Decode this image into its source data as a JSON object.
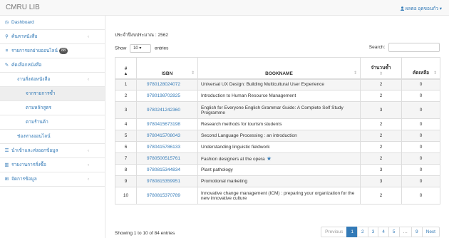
{
  "app": {
    "brand": "CMRU LIB",
    "user": "ผลตอ อุดขอนกัว"
  },
  "sidebar": {
    "items": [
      {
        "label": "Dashboard",
        "icon": "dashboard-icon",
        "glyph": "◷",
        "level": 1,
        "arrow": "",
        "badge": "",
        "active": false
      },
      {
        "label": "ค้นหาหนังสือ",
        "icon": "search-icon",
        "glyph": "⚲",
        "level": 1,
        "arrow": "‹",
        "badge": "",
        "active": false
      },
      {
        "label": "รายการยกย่ายออนไลน์",
        "icon": "cart-icon",
        "glyph": "≡",
        "level": 1,
        "arrow": "",
        "badge": "88",
        "active": false
      },
      {
        "label": "คัดเลือกหนังสือ",
        "icon": "edit-icon",
        "glyph": "✎",
        "level": 1,
        "arrow": "",
        "badge": "",
        "active": false
      },
      {
        "label": "งานสั่งต่อหนังสือ",
        "icon": "",
        "glyph": "",
        "level": 2,
        "arrow": "‹",
        "badge": "",
        "active": false
      },
      {
        "label": "จากรายการซ้ำ",
        "icon": "",
        "glyph": "",
        "level": 3,
        "arrow": "",
        "badge": "",
        "active": true
      },
      {
        "label": "ตามหลักสูตร",
        "icon": "",
        "glyph": "",
        "level": 3,
        "arrow": "",
        "badge": "",
        "active": false
      },
      {
        "label": "ตามร้านค้า",
        "icon": "",
        "glyph": "",
        "level": 3,
        "arrow": "",
        "badge": "",
        "active": false
      },
      {
        "label": "ช่องทางออนไลน์",
        "icon": "",
        "glyph": "",
        "level": 2,
        "arrow": "",
        "badge": "",
        "active": false
      },
      {
        "label": "นำเข้าและส่งออกข้อมูล",
        "icon": "list-icon",
        "glyph": "☰",
        "level": 1,
        "arrow": "‹",
        "badge": "",
        "active": false
      },
      {
        "label": "รายงานการสั่งซื้อ",
        "icon": "bar-chart-icon",
        "glyph": "▥",
        "level": 1,
        "arrow": "‹",
        "badge": "",
        "active": false
      },
      {
        "label": "จัดการข้อมูล",
        "icon": "sitemap-icon",
        "glyph": "⊞",
        "level": 1,
        "arrow": "‹",
        "badge": "",
        "active": false
      }
    ]
  },
  "main": {
    "year_label": "ประจำปีงบประมาณ : 2562",
    "show_prefix": "Show",
    "show_value": "10",
    "show_suffix": "entries",
    "search_label": "Search:",
    "columns": {
      "no": "#",
      "isbn": "ISBN",
      "bookname": "BOOKNAME",
      "repeat": "จำนวนซ้ำ",
      "remain": "คัดเหลือ"
    },
    "rows": [
      {
        "no": "1",
        "isbn": "9780128024072",
        "name": "Universal UX Design: Building Multicultural User Experience",
        "repeat": "2",
        "remain": "0",
        "star": false
      },
      {
        "no": "2",
        "isbn": "9780198702825",
        "name": "Introduction to Human Resource Management",
        "repeat": "2",
        "remain": "0",
        "star": false
      },
      {
        "no": "3",
        "isbn": "9780241242360",
        "name": "English for Everyone English Grammar Guide: A Complete Self Study Programme",
        "repeat": "3",
        "remain": "0",
        "star": false
      },
      {
        "no": "4",
        "isbn": "9780415673198",
        "name": "Research methods for tourism students",
        "repeat": "2",
        "remain": "0",
        "star": false
      },
      {
        "no": "5",
        "isbn": "9780415708043",
        "name": "Second Language Processing : an introduction",
        "repeat": "2",
        "remain": "0",
        "star": false
      },
      {
        "no": "6",
        "isbn": "9780415786133",
        "name": "Understanding linguistic fieldwork",
        "repeat": "2",
        "remain": "0",
        "star": false
      },
      {
        "no": "7",
        "isbn": "9780500515761",
        "name": "Fashion designers at the opera",
        "repeat": "2",
        "remain": "0",
        "star": true
      },
      {
        "no": "8",
        "isbn": "9780815344834",
        "name": "Plant pathology",
        "repeat": "3",
        "remain": "0",
        "star": false
      },
      {
        "no": "9",
        "isbn": "9780815359951",
        "name": "Promotional marketing",
        "repeat": "3",
        "remain": "0",
        "star": false
      },
      {
        "no": "10",
        "isbn": "9780815370789",
        "name": "Innovative change management (ICM) : preparing your organization for the new innovative culture",
        "repeat": "2",
        "remain": "0",
        "star": false
      }
    ],
    "showing": "Showing 1 to 10 of 84 entries",
    "pagination": [
      "Previous",
      "1",
      "2",
      "3",
      "4",
      "5",
      "…",
      "9",
      "Next"
    ],
    "active_page": "1"
  }
}
